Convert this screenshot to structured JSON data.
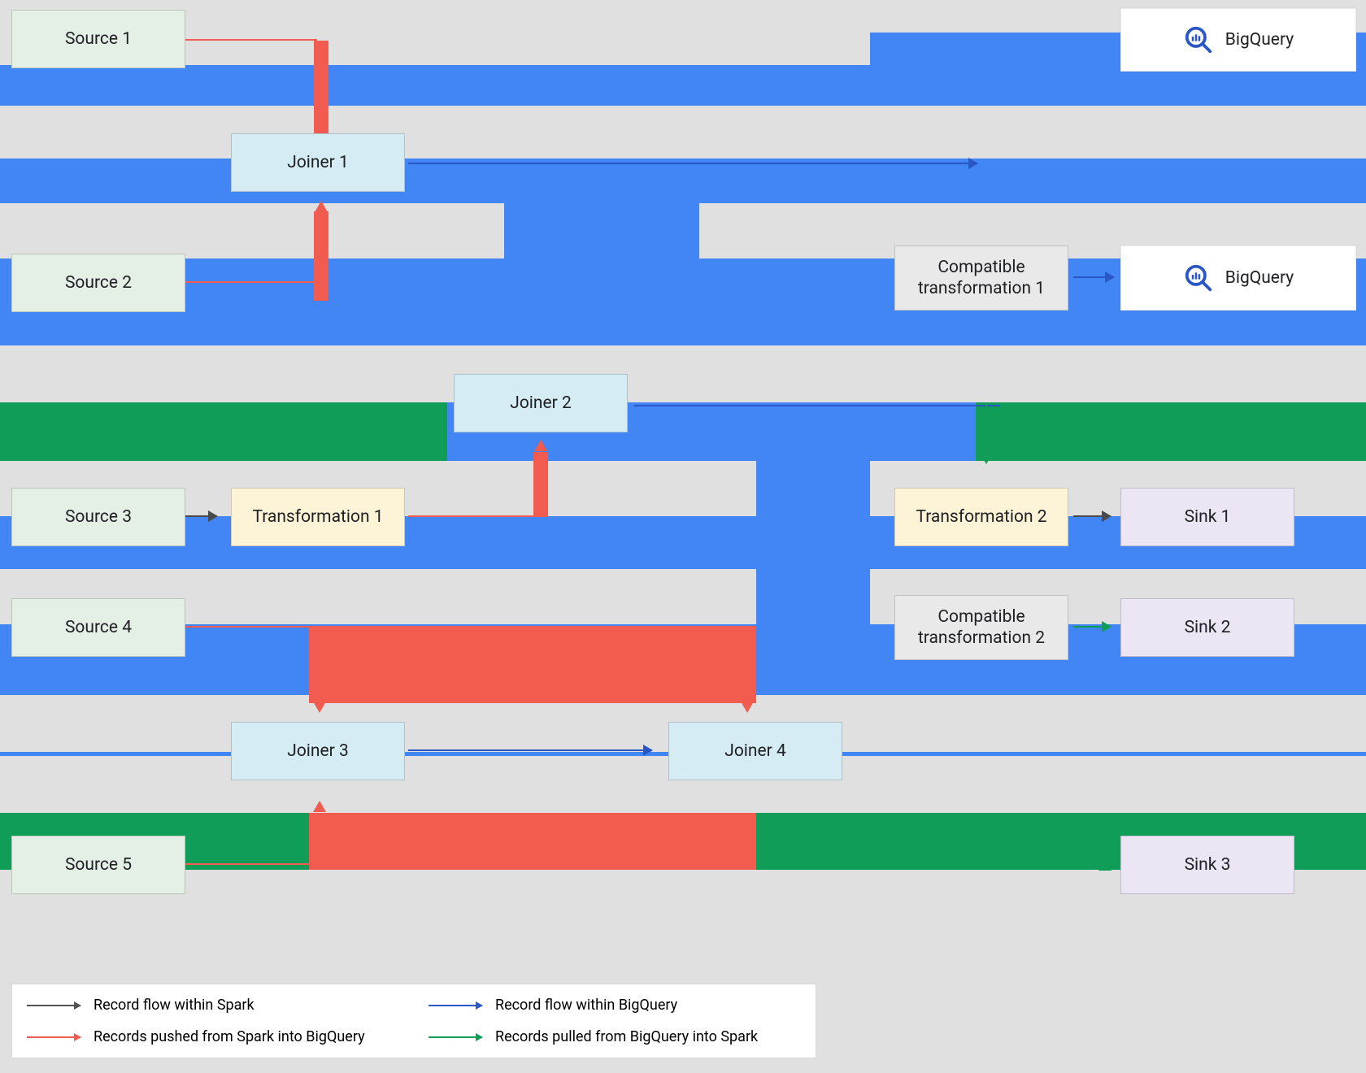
{
  "nodes": {
    "source1": "Source 1",
    "source2": "Source 2",
    "source3": "Source 3",
    "source4": "Source 4",
    "source5": "Source 5",
    "joiner1": "Joiner 1",
    "joiner2": "Joiner 2",
    "joiner3": "Joiner 3",
    "joiner4": "Joiner 4",
    "transformation1": "Transformation 1",
    "transformation2": "Transformation 2",
    "compat1": "Compatible transformation 1",
    "compat2": "Compatible transformation 2",
    "sink1": "Sink 1",
    "sink2": "Sink 2",
    "sink3": "Sink 3",
    "bigquery": "BigQuery"
  },
  "legend": {
    "spark_flow": "Record flow within Spark",
    "bq_flow": "Record flow within BigQuery",
    "push": "Records pushed from Spark into BigQuery",
    "pull": "Records pulled from BigQuery into Spark"
  },
  "colors": {
    "blue": "#4285f4",
    "green": "#0f9d58",
    "red": "#f25b50",
    "grey": "#e0e0e0"
  },
  "diagram_semantics": {
    "edges": [
      {
        "from": "source1",
        "to": "joiner1",
        "type": "push"
      },
      {
        "from": "source2",
        "to": "joiner1",
        "type": "push"
      },
      {
        "from": "joiner1",
        "to": "compat1",
        "type": "bq_flow"
      },
      {
        "from": "compat1",
        "to": "bigquery",
        "type": "bq_flow"
      },
      {
        "from": "joiner1",
        "to": "joiner2",
        "type": "bq_flow"
      },
      {
        "from": "source3",
        "to": "transformation1",
        "type": "spark_flow"
      },
      {
        "from": "transformation1",
        "to": "joiner2",
        "type": "push"
      },
      {
        "from": "joiner2",
        "to": "transformation2",
        "type": "pull"
      },
      {
        "from": "transformation2",
        "to": "sink1",
        "type": "spark_flow"
      },
      {
        "from": "joiner2",
        "to": "compat2",
        "type": "bq_flow"
      },
      {
        "from": "compat2",
        "to": "sink2",
        "type": "pull"
      },
      {
        "from": "source4",
        "to": "joiner3",
        "type": "push"
      },
      {
        "from": "source5",
        "to": "joiner3",
        "type": "push"
      },
      {
        "from": "joiner3",
        "to": "joiner4",
        "type": "bq_flow"
      },
      {
        "from": "joiner2",
        "to": "joiner4",
        "type": "bq_flow"
      },
      {
        "from": "joiner4",
        "to": "sink3",
        "type": "pull"
      },
      {
        "from": "source1",
        "to": "bigquery",
        "type": "bq_flow"
      }
    ],
    "node_types": {
      "source": [
        "source1",
        "source2",
        "source3",
        "source4",
        "source5"
      ],
      "joiner": [
        "joiner1",
        "joiner2",
        "joiner3",
        "joiner4"
      ],
      "transformation": [
        "transformation1",
        "transformation2"
      ],
      "compatible_transformation": [
        "compat1",
        "compat2"
      ],
      "sink": [
        "sink1",
        "sink2",
        "sink3"
      ],
      "bigquery_sink": [
        "bigquery"
      ]
    }
  }
}
